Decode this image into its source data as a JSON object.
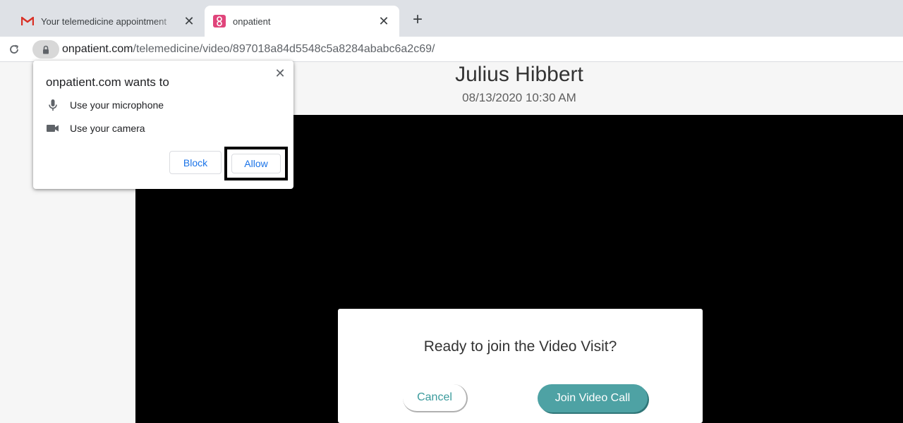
{
  "browser": {
    "tabs": [
      {
        "title": "Your telemedicine appointment",
        "favicon": "gmail-icon",
        "active": false
      },
      {
        "title": "onpatient",
        "favicon": "onpatient-icon",
        "active": true
      }
    ],
    "new_tab_label": "+",
    "url_domain": "onpatient.com",
    "url_path": "/telemedicine/video/897018a84d5548c5a8284ababc6a2c69/"
  },
  "permission_prompt": {
    "title": "onpatient.com wants to",
    "items": [
      {
        "label": "Use your microphone",
        "icon": "microphone-icon"
      },
      {
        "label": "Use your camera",
        "icon": "camera-icon"
      }
    ],
    "block_label": "Block",
    "allow_label": "Allow"
  },
  "appointment": {
    "doctor_name": "Julius Hibbert",
    "datetime": "08/13/2020 10:30 AM"
  },
  "join_dialog": {
    "title": "Ready to join the Video Visit?",
    "cancel_label": "Cancel",
    "join_label": "Join Video Call"
  },
  "colors": {
    "accent_teal": "#4ea2a4",
    "chrome_blue": "#1a73e8",
    "gmail_red": "#d93025",
    "onpatient_pink": "#e0457b"
  }
}
